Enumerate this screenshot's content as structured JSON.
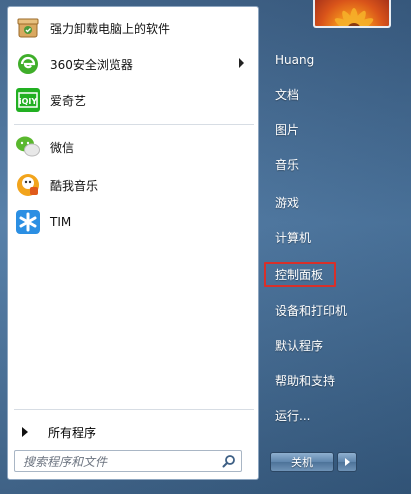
{
  "pinned_programs": [
    {
      "label": "强力卸载电脑上的软件",
      "icon": "uninstaller-icon",
      "has_submenu": false
    },
    {
      "label": "360安全浏览器",
      "icon": "browser-360-icon",
      "has_submenu": true
    },
    {
      "label": "爱奇艺",
      "icon": "iqiyi-icon",
      "has_submenu": false
    }
  ],
  "recent_programs": [
    {
      "label": "微信",
      "icon": "wechat-icon"
    },
    {
      "label": "酷我音乐",
      "icon": "kuwo-music-icon"
    },
    {
      "label": "TIM",
      "icon": "tim-icon"
    }
  ],
  "all_programs_label": "所有程序",
  "search": {
    "placeholder": "搜索程序和文件"
  },
  "right_menu": [
    {
      "label": "Huang"
    },
    {
      "label": "文档"
    },
    {
      "label": "图片"
    },
    {
      "label": "音乐"
    },
    {
      "label": "游戏"
    },
    {
      "label": "计算机"
    },
    {
      "label": "控制面板",
      "highlighted": true
    },
    {
      "label": "设备和打印机"
    },
    {
      "label": "默认程序"
    },
    {
      "label": "帮助和支持"
    },
    {
      "label": "运行..."
    }
  ],
  "shutdown": {
    "label": "关机"
  },
  "colors": {
    "highlight_border": "#d8302a",
    "panel_bg": "#ffffff",
    "right_text": "#ffffff"
  }
}
